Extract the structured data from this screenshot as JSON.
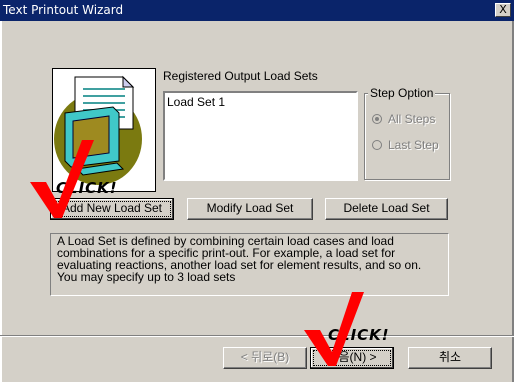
{
  "window": {
    "title": "Text Printout Wizard",
    "close_label": "X"
  },
  "load_sets": {
    "heading": "Registered Output Load Sets",
    "items": [
      "Load Set 1"
    ]
  },
  "step_option": {
    "title": "Step Option",
    "options": [
      {
        "label": "All Steps",
        "selected": true,
        "enabled": false
      },
      {
        "label": "Last Step",
        "selected": false,
        "enabled": false
      }
    ]
  },
  "actions": {
    "add": "Add New Load Set",
    "modify": "Modify Load Set",
    "delete": "Delete Load Set"
  },
  "description": {
    "lines": [
      " A Load Set is defined by combining certain load cases and load",
      "combinations for a specific print-out. For example, a load set for",
      "evaluating reactions, another load set for element results, and so on.",
      "You may specify up to 3 load sets"
    ]
  },
  "nav": {
    "back": "< 뒤로(B)",
    "next": "다음(N) >",
    "cancel": "취소"
  },
  "annotations": {
    "click_text": "CLICK!",
    "check_color": "#ff0000"
  },
  "colors": {
    "titlebar": "#0a246a",
    "face": "#d4d0c8",
    "monitor_screen": "#9e8a20",
    "monitor_body": "#40c8c8",
    "circle": "#7b7a10"
  },
  "icons": [
    "wizard-illustration-icon",
    "close-icon",
    "checkmark-icon"
  ]
}
